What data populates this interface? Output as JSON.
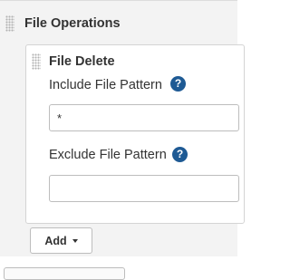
{
  "section": {
    "title": "File Operations"
  },
  "file_delete": {
    "title": "File Delete",
    "include": {
      "label": "Include File Pattern",
      "value": "*",
      "help": "?"
    },
    "exclude": {
      "label": "Exclude File Pattern",
      "value": "",
      "help": "?"
    }
  },
  "add_button": {
    "label": "Add"
  },
  "icons": {
    "drag_handle": "grip-dots-icon",
    "help": "question-circle-icon",
    "dropdown": "caret-down-icon"
  },
  "colors": {
    "help_icon": "#1e5a94",
    "section_background": "#f3f3f3",
    "panel_background": "#ffffff"
  }
}
